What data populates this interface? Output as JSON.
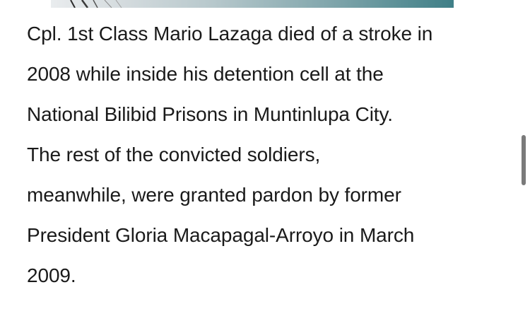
{
  "article": {
    "paragraph_lines": [
      "Cpl. 1st Class Mario Lazaga died of a stroke in",
      "2008 while inside his detention cell at the",
      "National Bilibid Prisons in Muntinlupa City.",
      "The rest of the convicted soldiers,",
      "meanwhile, were granted pardon by former",
      "President Gloria Macapagal-Arroyo in March",
      "2009."
    ]
  },
  "colors": {
    "text": "#1a1a1a",
    "background": "#ffffff",
    "scrollbar_thumb": "#7a7a7a",
    "image_accent": "#3f7f87"
  }
}
